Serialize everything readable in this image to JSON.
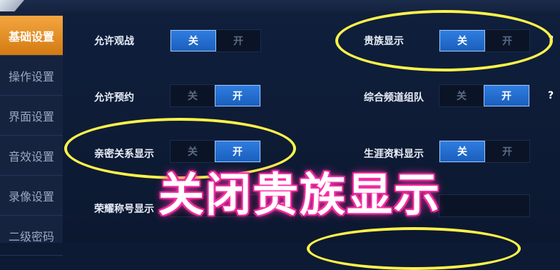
{
  "sidebar": {
    "items": [
      {
        "label": "基础设置"
      },
      {
        "label": "操作设置"
      },
      {
        "label": "界面设置"
      },
      {
        "label": "音效设置"
      },
      {
        "label": "录像设置"
      },
      {
        "label": "二级密码"
      }
    ],
    "active_index": 0
  },
  "settings": {
    "allow_spectate": {
      "label": "允许观战",
      "off": "关",
      "on": "开",
      "state": "off"
    },
    "noble_display": {
      "label": "贵族显示",
      "off": "关",
      "on": "开",
      "state": "off",
      "help": "?"
    },
    "allow_reservation": {
      "label": "允许预约",
      "off": "关",
      "on": "开",
      "state": "on"
    },
    "channel_team": {
      "label": "综合频道组队",
      "off": "关",
      "on": "开",
      "state": "on",
      "help": "?"
    },
    "intimacy_display": {
      "label": "亲密关系显示",
      "off": "关",
      "on": "开",
      "state": "on"
    },
    "career_display": {
      "label": "生涯资料显示",
      "off": "关",
      "on": "开",
      "state": "off"
    },
    "honor_title_display": {
      "label": "荣耀称号显示",
      "help": "?"
    }
  },
  "overlay": {
    "caption": "关闭贵族显示"
  },
  "colors": {
    "accent_orange": "#f4a640",
    "toggle_blue": "#2f7de0",
    "highlight_yellow": "#fff34a",
    "caption_glow": "#ff2fa8"
  }
}
